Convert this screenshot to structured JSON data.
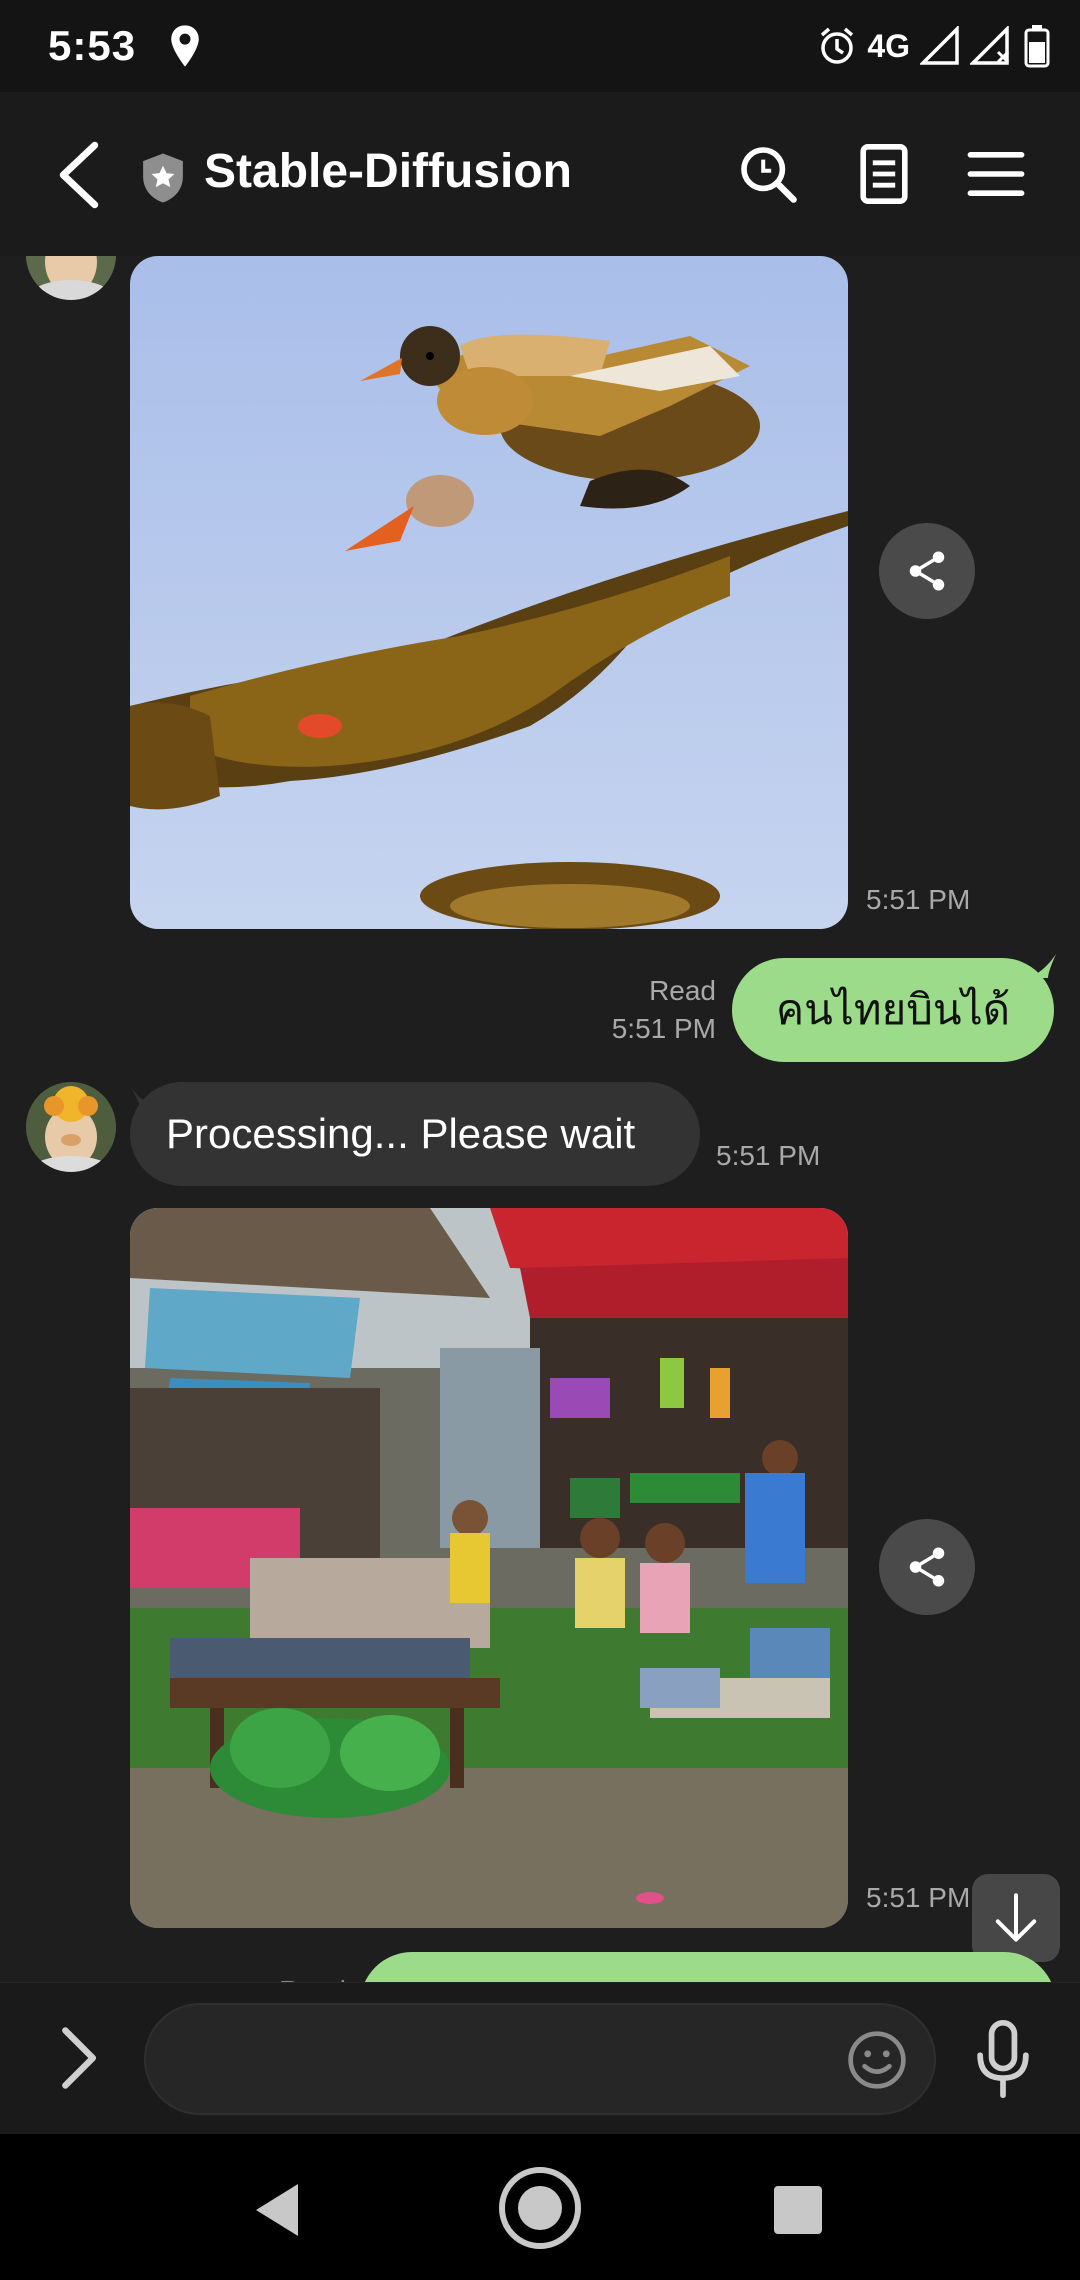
{
  "status_bar": {
    "time": "5:53",
    "network": "4G",
    "icons": [
      "location-icon",
      "alarm-icon",
      "signal-icon",
      "signal-no-data-icon",
      "battery-icon"
    ]
  },
  "header": {
    "title": "Stable-Diffusion",
    "icons": [
      "back-icon",
      "shield-icon",
      "search-icon",
      "notes-icon",
      "menu-icon"
    ]
  },
  "messages": [
    {
      "type": "image",
      "sender": "bot",
      "alt": "generated image of a flying duck",
      "time": "5:51 PM"
    },
    {
      "type": "text",
      "sender": "me",
      "text": "คนไทยบินได้",
      "read_label": "Read",
      "time": "5:51 PM"
    },
    {
      "type": "text",
      "sender": "bot",
      "text": "Processing... Please wait",
      "time": "5:51 PM"
    },
    {
      "type": "image",
      "sender": "bot",
      "alt": "generated image of a Thai market",
      "time": "5:51 PM"
    },
    {
      "type": "text",
      "sender": "me",
      "text": "",
      "read_label": "Read",
      "time": ""
    }
  ],
  "input": {
    "placeholder": "",
    "value": ""
  },
  "colors": {
    "outgoing_bubble": "#9cdb8a",
    "incoming_bubble": "#333333",
    "background": "#1e1e1e"
  }
}
